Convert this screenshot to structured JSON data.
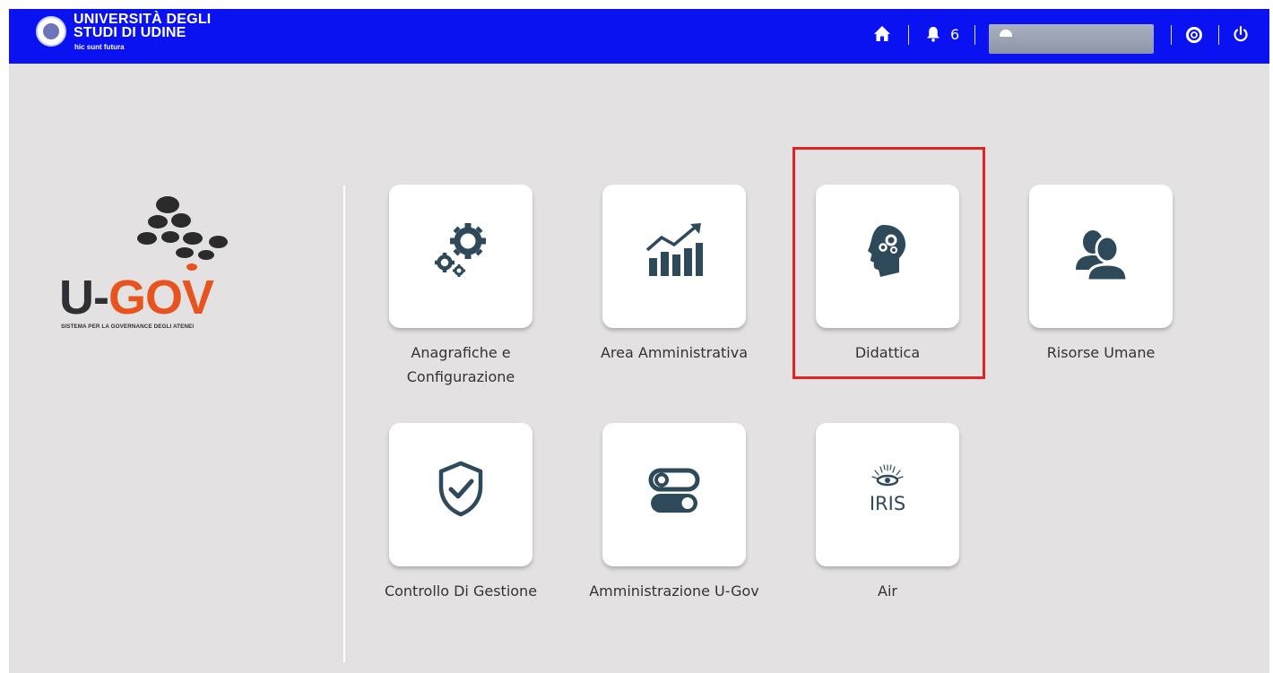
{
  "header": {
    "university_line1": "UNIVERSITÀ DEGLI",
    "university_line2": "STUDI DI UDINE",
    "motto": "hic sunt futura",
    "icons": [
      "university-seal-icon",
      "home-icon",
      "bell-icon",
      "user-icon",
      "help-icon",
      "power-icon"
    ],
    "notification_count": "6",
    "bar_color": "#0a12f2"
  },
  "branding": {
    "logo_left": "U-",
    "logo_right": "GOV",
    "tagline": "SISTEMA PER LA GOVERNANCE DEGLI ATENEI",
    "accent_color": "#e8541f"
  },
  "modules": [
    {
      "label": "Anagrafiche e Configurazione",
      "icon": "gears-icon"
    },
    {
      "label": "Area Amministrativa",
      "icon": "chart-growth-icon"
    },
    {
      "label": "Didattica",
      "icon": "head-gears-icon",
      "highlighted": true
    },
    {
      "label": "Risorse Umane",
      "icon": "users-icon"
    },
    {
      "label": "Controllo Di Gestione",
      "icon": "shield-check-icon"
    },
    {
      "label": "Amministrazione U-Gov",
      "icon": "toggles-icon"
    },
    {
      "label": "Air",
      "icon": "iris-logo-icon",
      "logo_text": "IRIS"
    }
  ],
  "colors": {
    "icon": "#2e4a5a",
    "highlight_border": "#e32223",
    "background": "#e3e1e1"
  }
}
